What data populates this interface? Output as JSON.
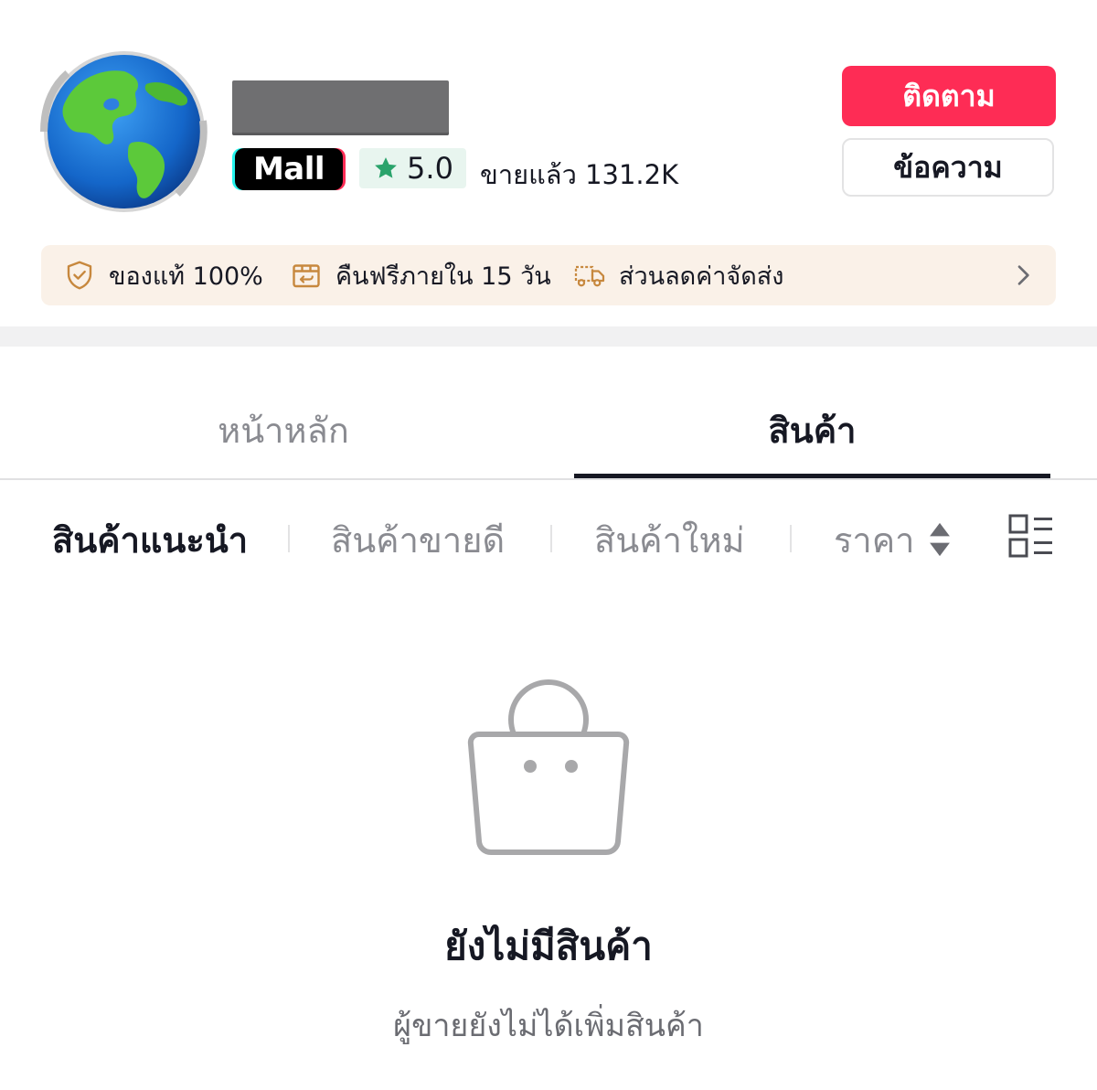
{
  "shop": {
    "badge": "Mall",
    "rating": "5.0",
    "sold": "ขายแล้ว 131.2K"
  },
  "actions": {
    "follow": "ติดตาม",
    "message": "ข้อความ"
  },
  "guarantees": [
    {
      "icon": "shield-check-icon",
      "label": "ของแท้ 100%"
    },
    {
      "icon": "return-box-icon",
      "label": "คืนฟรีภายใน 15 วัน"
    },
    {
      "icon": "delivery-truck-icon",
      "label": "ส่วนลดค่าจัดส่ง"
    }
  ],
  "tabs": [
    {
      "label": "หน้าหลัก",
      "active": false
    },
    {
      "label": "สินค้า",
      "active": true
    }
  ],
  "sort_options": [
    {
      "label": "สินค้าแนะนำ",
      "active": true
    },
    {
      "label": "สินค้าขายดี",
      "active": false
    },
    {
      "label": "สินค้าใหม่",
      "active": false
    },
    {
      "label": "ราคา",
      "active": false
    }
  ],
  "empty_state": {
    "icon": "shopping-bag-icon",
    "title": "ยังไม่มีสินค้า",
    "subtitle": "ผู้ขายยังไม่ได้เพิ่มสินค้า"
  },
  "colors": {
    "accent": "#fe2c55",
    "rating_star": "#2aa36b",
    "banner_bg": "#faf1e8",
    "banner_icon": "#c7883e"
  }
}
